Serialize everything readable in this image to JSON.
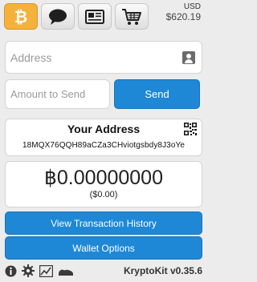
{
  "tabs": [
    {
      "name": "bitcoin-icon",
      "active": true
    },
    {
      "name": "chat-icon",
      "active": false
    },
    {
      "name": "newspaper-icon",
      "active": false
    },
    {
      "name": "cart-icon",
      "active": false
    }
  ],
  "balance_top": {
    "currency": "USD",
    "amount": "$620.19"
  },
  "address_input": {
    "placeholder": "Address",
    "value": ""
  },
  "amount_input": {
    "placeholder": "Amount to Send",
    "value": ""
  },
  "send_label": "Send",
  "your_address": {
    "title": "Your Address",
    "value": "18MQX76QQH89aCZa3CHviotgsbdy8J3oYe"
  },
  "balance": {
    "btc": "฿0.00000000",
    "usd": "($0.00)"
  },
  "buttons": {
    "history": "View Transaction History",
    "wallet": "Wallet Options"
  },
  "footer": {
    "icons": [
      "info-icon",
      "settings-icon",
      "chart-icon",
      "shoe-icon"
    ],
    "version": "KryptoKit v0.35.6"
  },
  "colors": {
    "accent": "#1e88d6",
    "active_tab": "#f4b23a"
  }
}
